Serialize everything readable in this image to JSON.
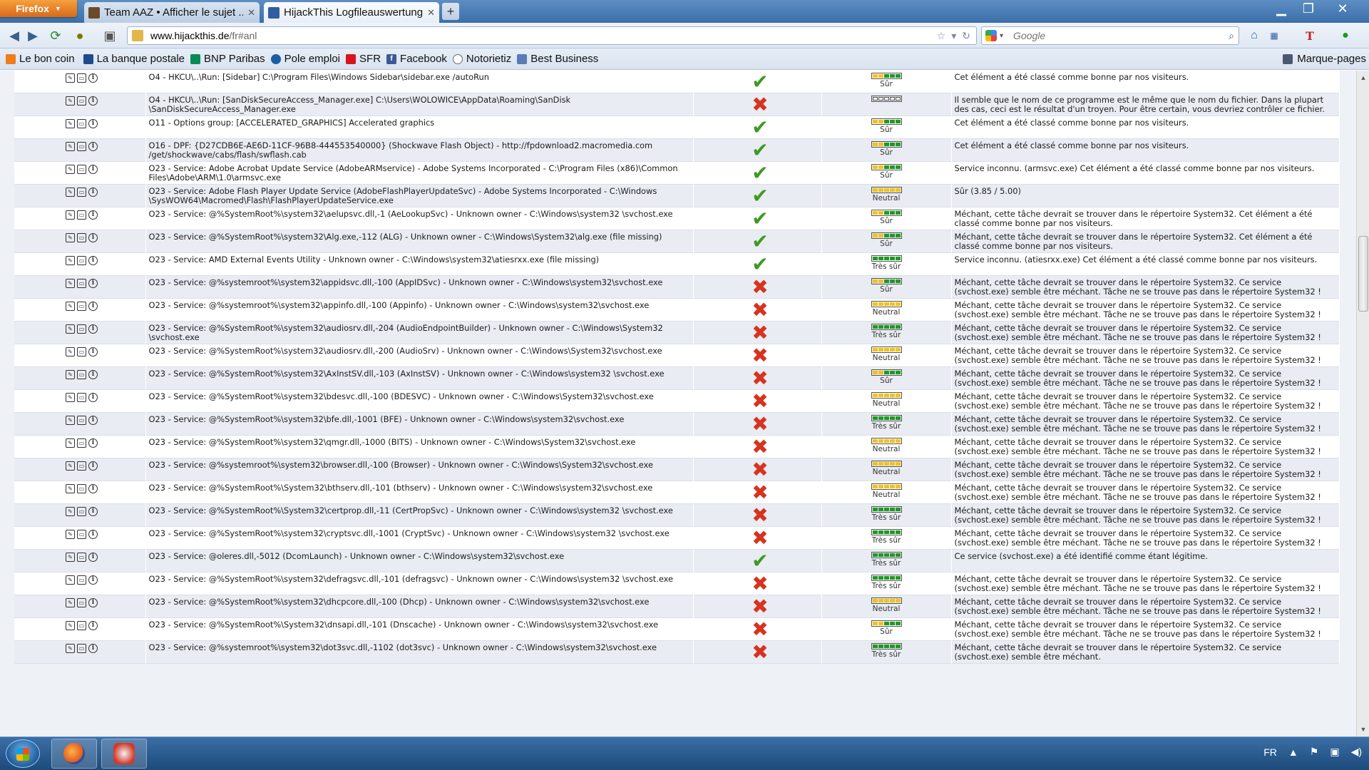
{
  "browser": {
    "menu_label": "Firefox",
    "tabs": [
      {
        "title": "Team AAZ • Afficher le sujet ...",
        "active": false
      },
      {
        "title": "HijackThis Logfileauswertung",
        "active": true
      }
    ],
    "url_host": "www.hijackthis.de",
    "url_path": "/fr#anl",
    "search_placeholder": "Google"
  },
  "bookmarks": [
    {
      "label": "Le bon coin",
      "icon": "leboncoin-icon",
      "color": "#f07d1a"
    },
    {
      "label": "La banque postale",
      "icon": "banque-postale-icon",
      "color": "#1f4b8e"
    },
    {
      "label": "BNP Paribas",
      "icon": "bnp-icon",
      "color": "#0a8a55"
    },
    {
      "label": "Pole emploi",
      "icon": "pole-emploi-icon",
      "color": "#1b5fa3"
    },
    {
      "label": "SFR",
      "icon": "sfr-icon",
      "color": "#d9151b"
    },
    {
      "label": "Facebook",
      "icon": "facebook-icon",
      "color": "#3b5998"
    },
    {
      "label": "Notorietiz",
      "icon": "notorietiz-icon",
      "color": "#6b6b6b"
    },
    {
      "label": "Best Business",
      "icon": "best-business-icon",
      "color": "#5b7bb5"
    }
  ],
  "bookmarks_menu_label": "Marque-pages",
  "colors": {
    "rating_green": "#1e9a22",
    "rating_yellow": "#f2c21c",
    "rating_empty": "#ffffff",
    "check_green": "#3e9a21",
    "cross_red": "#d7331e"
  },
  "ratings": {
    "sur": {
      "label": "Sûr",
      "level": 0.6
    },
    "tres_sur": {
      "label": "Très sûr",
      "level": 1.0
    },
    "neutral": {
      "label": "Neutral",
      "level": 0.5
    },
    "unknown": {
      "label": "",
      "level": 0
    }
  },
  "rows": [
    {
      "entry": "O4 - HKCU\\..\\Run: [Sidebar] C:\\Program Files\\Windows Sidebar\\sidebar.exe /autoRun",
      "status": "ok",
      "rating": "sur",
      "description": "Cet élément a été classé comme bonne par nos visiteurs."
    },
    {
      "entry": "O4 - HKCU\\..\\Run: [SanDiskSecureAccess_Manager.exe] C:\\Users\\WOLOWICE\\AppData\\Roaming\\SanDisk \\SanDiskSecureAccess_Manager.exe",
      "status": "bad",
      "rating": "unknown",
      "description": "Il semble que le nom de ce programme est le même que le nom du fichier. Dans la plupart des cas, ceci est le résultat d'un troyen. Pour être certain, vous devriez contrôler ce fichier."
    },
    {
      "entry": "O11 - Options group: [ACCELERATED_GRAPHICS] Accelerated graphics",
      "status": "ok",
      "rating": "sur",
      "description": "Cet élément a été classé comme bonne par nos visiteurs."
    },
    {
      "entry": "O16 - DPF: {D27CDB6E-AE6D-11CF-96B8-444553540000} (Shockwave Flash Object) - http://fpdownload2.macromedia.com /get/shockwave/cabs/flash/swflash.cab",
      "status": "ok",
      "rating": "sur",
      "description": "Cet élément a été classé comme bonne par nos visiteurs."
    },
    {
      "entry": "O23 - Service: Adobe Acrobat Update Service (AdobeARMservice) - Adobe Systems Incorporated - C:\\Program Files (x86)\\Common Files\\Adobe\\ARM\\1.0\\armsvc.exe",
      "status": "ok",
      "rating": "sur",
      "description": "Service inconnu. (armsvc.exe) Cet élément a été classé comme bonne par nos visiteurs."
    },
    {
      "entry": "O23 - Service: Adobe Flash Player Update Service (AdobeFlashPlayerUpdateSvc) - Adobe Systems Incorporated - C:\\Windows \\SysWOW64\\Macromed\\Flash\\FlashPlayerUpdateService.exe",
      "status": "ok",
      "rating": "neutral",
      "description": "Sûr (3.85 / 5.00)"
    },
    {
      "entry": "O23 - Service: @%SystemRoot%\\system32\\aelupsvc.dll,-1 (AeLookupSvc) - Unknown owner - C:\\Windows\\system32 \\svchost.exe",
      "status": "ok",
      "rating": "sur",
      "description": "Méchant, cette tâche devrait se trouver dans le répertoire System32. Cet élément a été classé comme bonne par nos visiteurs."
    },
    {
      "entry": "O23 - Service: @%SystemRoot%\\system32\\Alg.exe,-112 (ALG) - Unknown owner - C:\\Windows\\System32\\alg.exe (file missing)",
      "status": "ok",
      "rating": "sur",
      "description": "Méchant, cette tâche devrait se trouver dans le répertoire System32. Cet élément a été classé comme bonne par nos visiteurs."
    },
    {
      "entry": "O23 - Service: AMD External Events Utility - Unknown owner - C:\\Windows\\system32\\atiesrxx.exe (file missing)",
      "status": "ok",
      "rating": "tres_sur",
      "description": "Service inconnu. (atiesrxx.exe) Cet élément a été classé comme bonne par nos visiteurs."
    },
    {
      "entry": "O23 - Service: @%systemroot%\\system32\\appidsvc.dll,-100 (AppIDSvc) - Unknown owner - C:\\Windows\\system32\\svchost.exe",
      "status": "bad",
      "rating": "sur",
      "description": "Méchant, cette tâche devrait se trouver dans le répertoire System32. Ce service (svchost.exe) semble être méchant. Tâche ne se trouve pas dans le répertoire System32 !"
    },
    {
      "entry": "O23 - Service: @%systemroot%\\system32\\appinfo.dll,-100 (Appinfo) - Unknown owner - C:\\Windows\\system32\\svchost.exe",
      "status": "bad",
      "rating": "neutral",
      "description": "Méchant, cette tâche devrait se trouver dans le répertoire System32. Ce service (svchost.exe) semble être méchant. Tâche ne se trouve pas dans le répertoire System32 !"
    },
    {
      "entry": "O23 - Service: @%SystemRoot%\\system32\\audiosrv.dll,-204 (AudioEndpointBuilder) - Unknown owner - C:\\Windows\\System32 \\svchost.exe",
      "status": "bad",
      "rating": "tres_sur",
      "description": "Méchant, cette tâche devrait se trouver dans le répertoire System32. Ce service (svchost.exe) semble être méchant. Tâche ne se trouve pas dans le répertoire System32 !"
    },
    {
      "entry": "O23 - Service: @%SystemRoot%\\system32\\audiosrv.dll,-200 (AudioSrv) - Unknown owner - C:\\Windows\\System32\\svchost.exe",
      "status": "bad",
      "rating": "neutral",
      "description": "Méchant, cette tâche devrait se trouver dans le répertoire System32. Ce service (svchost.exe) semble être méchant. Tâche ne se trouve pas dans le répertoire System32 !"
    },
    {
      "entry": "O23 - Service: @%SystemRoot%\\system32\\AxInstSV.dll,-103 (AxInstSV) - Unknown owner - C:\\Windows\\system32 \\svchost.exe",
      "status": "bad",
      "rating": "sur",
      "description": "Méchant, cette tâche devrait se trouver dans le répertoire System32. Ce service (svchost.exe) semble être méchant. Tâche ne se trouve pas dans le répertoire System32 !"
    },
    {
      "entry": "O23 - Service: @%SystemRoot%\\system32\\bdesvc.dll,-100 (BDESVC) - Unknown owner - C:\\Windows\\System32\\svchost.exe",
      "status": "bad",
      "rating": "neutral",
      "description": "Méchant, cette tâche devrait se trouver dans le répertoire System32. Ce service (svchost.exe) semble être méchant. Tâche ne se trouve pas dans le répertoire System32 !"
    },
    {
      "entry": "O23 - Service: @%SystemRoot%\\system32\\bfe.dll,-1001 (BFE) - Unknown owner - C:\\Windows\\system32\\svchost.exe",
      "status": "bad",
      "rating": "tres_sur",
      "description": "Méchant, cette tâche devrait se trouver dans le répertoire System32. Ce service (svchost.exe) semble être méchant. Tâche ne se trouve pas dans le répertoire System32 !"
    },
    {
      "entry": "O23 - Service: @%SystemRoot%\\system32\\qmgr.dll,-1000 (BITS) - Unknown owner - C:\\Windows\\System32\\svchost.exe",
      "status": "bad",
      "rating": "neutral",
      "description": "Méchant, cette tâche devrait se trouver dans le répertoire System32. Ce service (svchost.exe) semble être méchant. Tâche ne se trouve pas dans le répertoire System32 !"
    },
    {
      "entry": "O23 - Service: @%systemroot%\\system32\\browser.dll,-100 (Browser) - Unknown owner - C:\\Windows\\System32\\svchost.exe",
      "status": "bad",
      "rating": "neutral",
      "description": "Méchant, cette tâche devrait se trouver dans le répertoire System32. Ce service (svchost.exe) semble être méchant. Tâche ne se trouve pas dans le répertoire System32 !"
    },
    {
      "entry": "O23 - Service: @%SystemRoot%\\System32\\bthserv.dll,-101 (bthserv) - Unknown owner - C:\\Windows\\system32\\svchost.exe",
      "status": "bad",
      "rating": "neutral",
      "description": "Méchant, cette tâche devrait se trouver dans le répertoire System32. Ce service (svchost.exe) semble être méchant. Tâche ne se trouve pas dans le répertoire System32 !"
    },
    {
      "entry": "O23 - Service: @%SystemRoot%\\System32\\certprop.dll,-11 (CertPropSvc) - Unknown owner - C:\\Windows\\system32 \\svchost.exe",
      "status": "bad",
      "rating": "tres_sur",
      "description": "Méchant, cette tâche devrait se trouver dans le répertoire System32. Ce service (svchost.exe) semble être méchant. Tâche ne se trouve pas dans le répertoire System32 !"
    },
    {
      "entry": "O23 - Service: @%SystemRoot%\\system32\\cryptsvc.dll,-1001 (CryptSvc) - Unknown owner - C:\\Windows\\system32 \\svchost.exe",
      "status": "bad",
      "rating": "tres_sur",
      "description": "Méchant, cette tâche devrait se trouver dans le répertoire System32. Ce service (svchost.exe) semble être méchant. Tâche ne se trouve pas dans le répertoire System32 !"
    },
    {
      "entry": "O23 - Service: @oleres.dll,-5012 (DcomLaunch) - Unknown owner - C:\\Windows\\system32\\svchost.exe",
      "status": "ok",
      "rating": "tres_sur",
      "description": "Ce service (svchost.exe) a été identifié comme étant légitime."
    },
    {
      "entry": "O23 - Service: @%SystemRoot%\\system32\\defragsvc.dll,-101 (defragsvc) - Unknown owner - C:\\Windows\\system32 \\svchost.exe",
      "status": "bad",
      "rating": "tres_sur",
      "description": "Méchant, cette tâche devrait se trouver dans le répertoire System32. Ce service (svchost.exe) semble être méchant. Tâche ne se trouve pas dans le répertoire System32 !"
    },
    {
      "entry": "O23 - Service: @%SystemRoot%\\system32\\dhcpcore.dll,-100 (Dhcp) - Unknown owner - C:\\Windows\\system32\\svchost.exe",
      "status": "bad",
      "rating": "neutral",
      "description": "Méchant, cette tâche devrait se trouver dans le répertoire System32. Ce service (svchost.exe) semble être méchant. Tâche ne se trouve pas dans le répertoire System32 !"
    },
    {
      "entry": "O23 - Service: @%SystemRoot%\\System32\\dnsapi.dll,-101 (Dnscache) - Unknown owner - C:\\Windows\\system32\\svchost.exe",
      "status": "bad",
      "rating": "sur",
      "description": "Méchant, cette tâche devrait se trouver dans le répertoire System32. Ce service (svchost.exe) semble être méchant. Tâche ne se trouve pas dans le répertoire System32 !"
    },
    {
      "entry": "O23 - Service: @%systemroot%\\system32\\dot3svc.dll,-1102 (dot3svc) - Unknown owner - C:\\Windows\\system32\\svchost.exe",
      "status": "bad",
      "rating": "tres_sur",
      "description": "Méchant, cette tâche devrait se trouver dans le répertoire System32. Ce service (svchost.exe) semble être méchant."
    }
  ],
  "taskbar": {
    "language": "FR"
  }
}
